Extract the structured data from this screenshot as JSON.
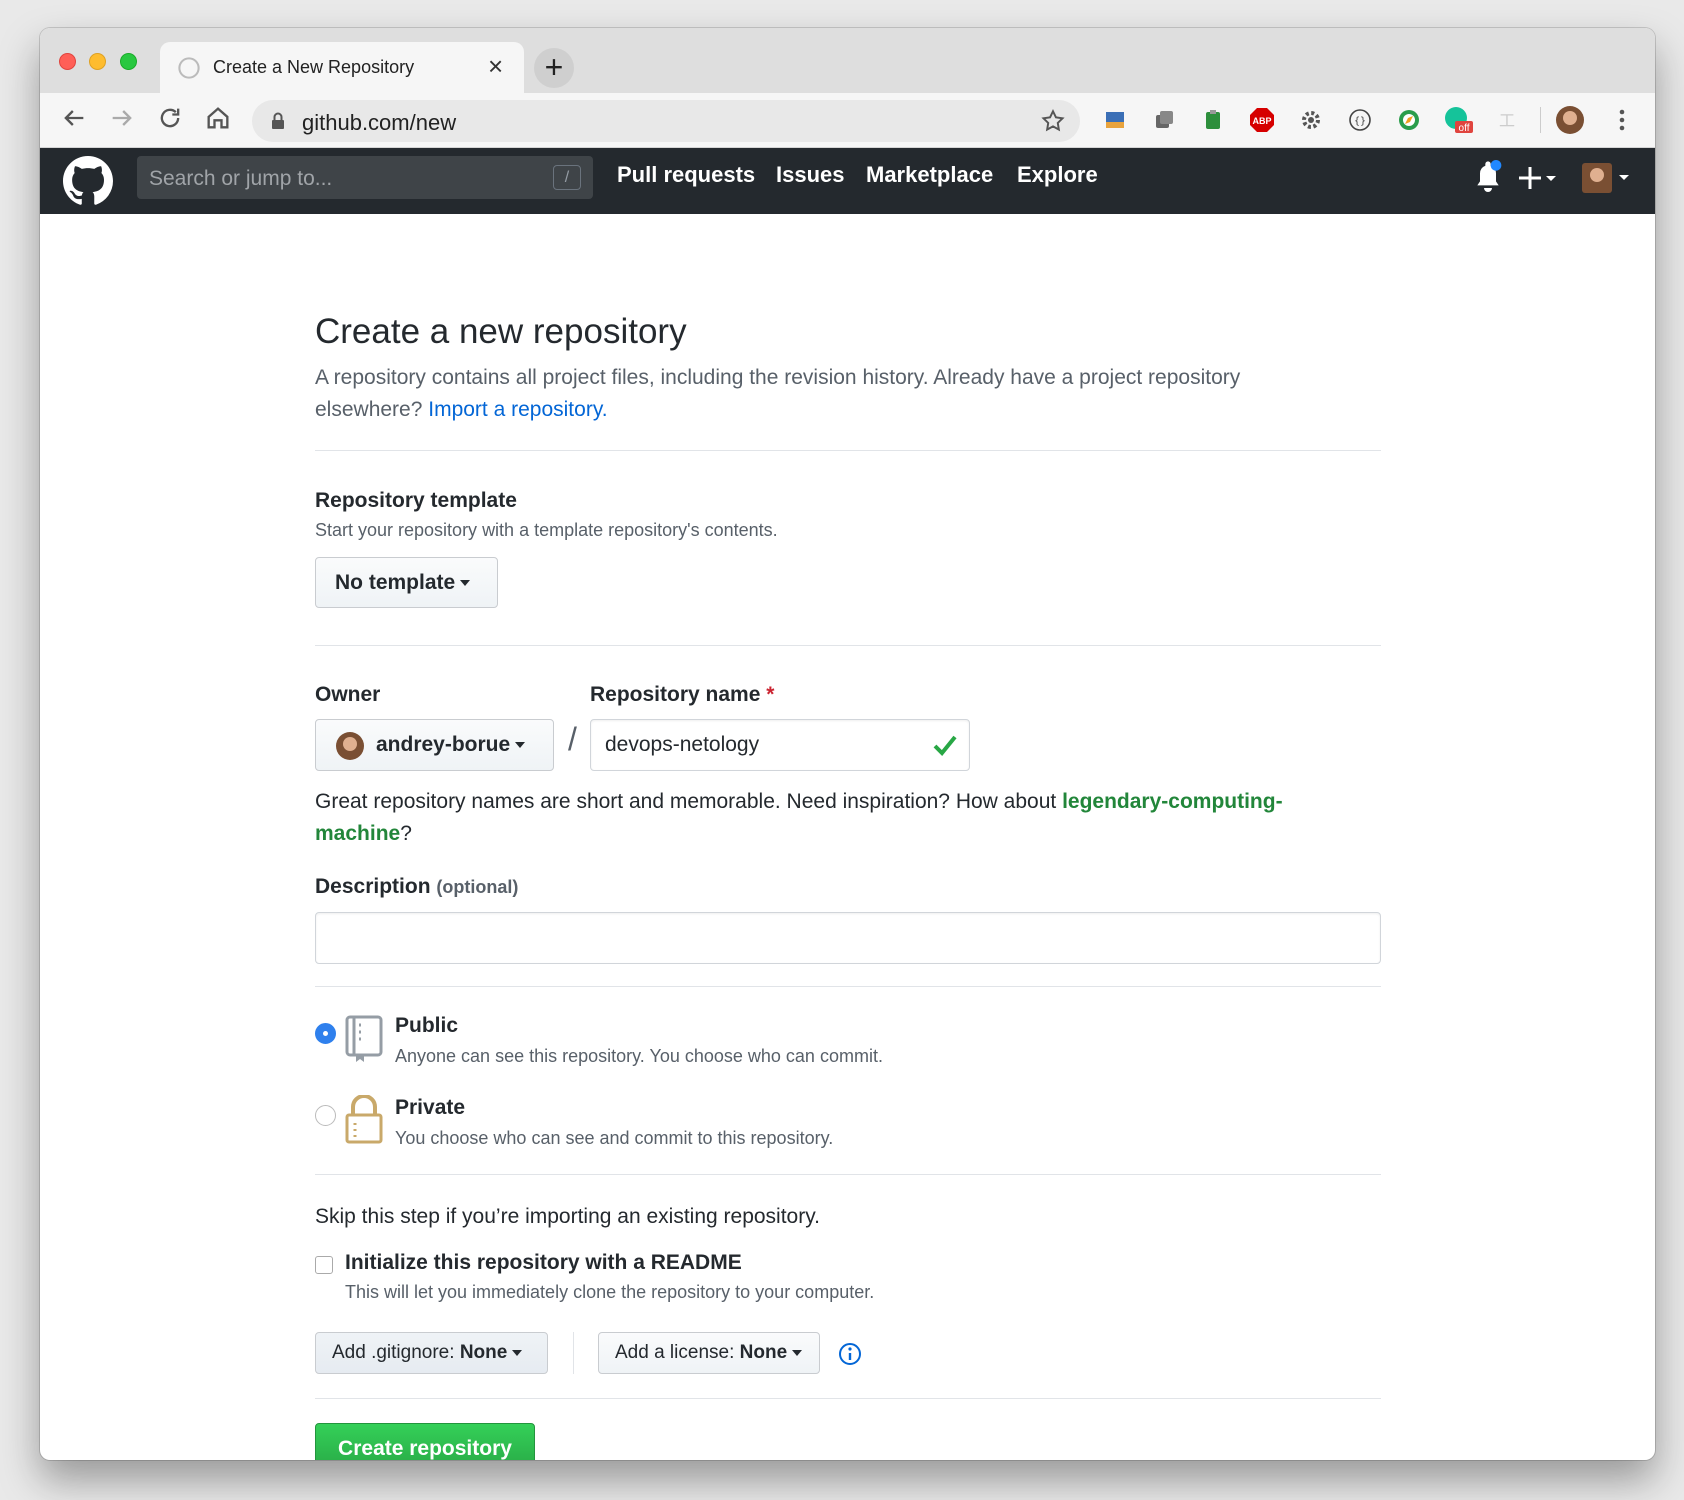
{
  "browser": {
    "tab_title": "Create a New Repository",
    "tab_close": "×",
    "new_tab": "+",
    "url": "github.com/new",
    "ext_off_badge": "off"
  },
  "github_header": {
    "search_placeholder": "Search or jump to...",
    "search_shortcut": "/",
    "nav": [
      "Pull requests",
      "Issues",
      "Marketplace",
      "Explore"
    ]
  },
  "page": {
    "title": "Create a new repository",
    "subhead_text": "A repository contains all project files, including the revision history. Already have a project repository elsewhere?",
    "import_link": "Import a repository."
  },
  "template": {
    "label": "Repository template",
    "note": "Start your repository with a template repository's contents.",
    "button": "No template"
  },
  "owner": {
    "label": "Owner",
    "value": "andrey-borue"
  },
  "separator": "/",
  "repo_name": {
    "label": "Repository name",
    "required_mark": "*",
    "value": "devops-netology",
    "hint_text": "Great repository names are short and memorable. Need inspiration? How about",
    "suggestion": "legendary-computing-machine",
    "hint_end": "?"
  },
  "description": {
    "label": "Description",
    "optional": "(optional)",
    "value": ""
  },
  "visibility": {
    "selected": "public",
    "options": [
      {
        "title": "Public",
        "desc": "Anyone can see this repository. You choose who can commit."
      },
      {
        "title": "Private",
        "desc": "You choose who can see and commit to this repository."
      }
    ]
  },
  "init": {
    "skip_note": "Skip this step if you’re importing an existing repository.",
    "readme_label": "Initialize this repository with a README",
    "readme_desc": "This will let you immediately clone the repository to your computer.",
    "readme_checked": false,
    "gitignore_prefix": "Add .gitignore:",
    "gitignore_value": "None",
    "license_prefix": "Add a license:",
    "license_value": "None"
  },
  "submit": {
    "label": "Create repository"
  },
  "colors": {
    "accent_blue": "#0366d6",
    "green": "#28a745",
    "suggestion_green": "#22863a",
    "header_bg": "#24292e"
  }
}
